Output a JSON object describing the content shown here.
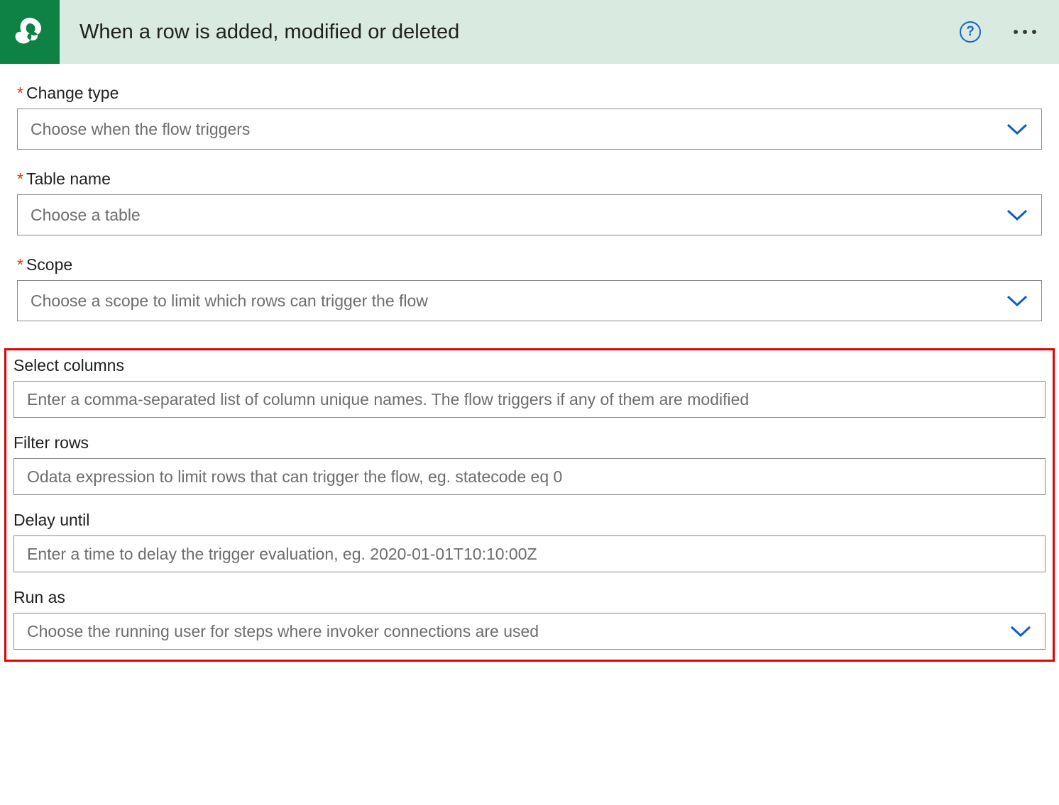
{
  "header": {
    "title": "When a row is added, modified or deleted",
    "help_icon": "question-mark",
    "more_icon": "more-horizontal"
  },
  "fields": {
    "change_type": {
      "label": "Change type",
      "required": true,
      "placeholder": "Choose when the flow triggers"
    },
    "table_name": {
      "label": "Table name",
      "required": true,
      "placeholder": "Choose a table"
    },
    "scope": {
      "label": "Scope",
      "required": true,
      "placeholder": "Choose a scope to limit which rows can trigger the flow"
    },
    "select_columns": {
      "label": "Select columns",
      "required": false,
      "placeholder": "Enter a comma-separated list of column unique names. The flow triggers if any of them are modified"
    },
    "filter_rows": {
      "label": "Filter rows",
      "required": false,
      "placeholder": "Odata expression to limit rows that can trigger the flow, eg. statecode eq 0"
    },
    "delay_until": {
      "label": "Delay until",
      "required": false,
      "placeholder": "Enter a time to delay the trigger evaluation, eg. 2020-01-01T10:10:00Z"
    },
    "run_as": {
      "label": "Run as",
      "required": false,
      "placeholder": "Choose the running user for steps where invoker connections are used"
    }
  },
  "required_marker": "*",
  "colors": {
    "brand_green": "#0d8244",
    "header_bg": "#d9eae0",
    "required": "#d83b01",
    "chevron": "#0d5cc6",
    "highlight": "#e60000"
  }
}
